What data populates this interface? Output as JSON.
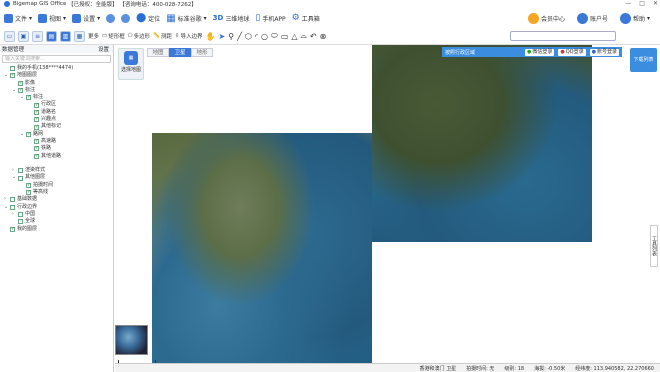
{
  "title": {
    "app": "Bigemap GIS Office",
    "license": "【已授权：全能版】",
    "phone": "【咨询电话：400-028-7262】"
  },
  "window_controls": [
    "—",
    "□",
    "✕"
  ],
  "menu": {
    "items": [
      "文件",
      "视图",
      "设置"
    ],
    "tools": [
      {
        "label": "定位",
        "icon": "pin-icon"
      },
      {
        "label": "标准谷歌",
        "icon": "grid-icon"
      },
      {
        "label": "三维地球",
        "icon": "3d-icon"
      },
      {
        "label": "手机APP",
        "icon": "phone-icon"
      },
      {
        "label": "工具箱",
        "icon": "gear-icon"
      }
    ],
    "right": [
      {
        "label": "会员中心"
      },
      {
        "label": "账户号"
      },
      {
        "label": "帮助"
      }
    ]
  },
  "toolbar": {
    "more": "更多",
    "items": [
      {
        "label": "矩形框"
      },
      {
        "label": "多边形"
      },
      {
        "label": "测距"
      },
      {
        "label": "导入边界"
      }
    ]
  },
  "panel": {
    "title": "数据管理",
    "action": "设置",
    "search_placeholder": "输入关键词搜索...",
    "tree": [
      {
        "label": "我的手机(138****4474)",
        "level": 0,
        "check": false,
        "arrow": ""
      },
      {
        "label": "地图图层",
        "level": 0,
        "check": true,
        "arrow": "⌄"
      },
      {
        "label": "影像",
        "level": 1,
        "check": true,
        "arrow": ""
      },
      {
        "label": "标注",
        "level": 1,
        "check": true,
        "arrow": "⌄"
      },
      {
        "label": "标注",
        "level": 2,
        "check": true,
        "arrow": "⌄"
      },
      {
        "label": "行政区",
        "level": 3,
        "check": true,
        "arrow": ""
      },
      {
        "label": "道路名",
        "level": 3,
        "check": true,
        "arrow": ""
      },
      {
        "label": "兴趣点",
        "level": 3,
        "check": true,
        "arrow": ""
      },
      {
        "label": "其他标记",
        "level": 3,
        "check": true,
        "arrow": ""
      },
      {
        "label": "路网",
        "level": 2,
        "check": true,
        "arrow": "⌄"
      },
      {
        "label": "高速路",
        "level": 3,
        "check": true,
        "arrow": ""
      },
      {
        "label": "铁路",
        "level": 3,
        "check": true,
        "arrow": ""
      },
      {
        "label": "其他道路",
        "level": 3,
        "check": true,
        "arrow": ""
      },
      {
        "label": "",
        "level": 0,
        "check": false,
        "arrow": ""
      },
      {
        "label": "渲染样式",
        "level": 1,
        "check": false,
        "arrow": "›"
      },
      {
        "label": "其他图层",
        "level": 1,
        "check": false,
        "arrow": "⌄"
      },
      {
        "label": "拍摄时间",
        "level": 2,
        "check": true,
        "arrow": ""
      },
      {
        "label": "等高线",
        "level": 2,
        "check": true,
        "arrow": ""
      },
      {
        "label": "基础数据",
        "level": 0,
        "check": false,
        "arrow": "›"
      },
      {
        "label": "行政边界",
        "level": 0,
        "check": false,
        "arrow": "⌄"
      },
      {
        "label": "中国",
        "level": 1,
        "check": false,
        "arrow": "›"
      },
      {
        "label": "全球",
        "level": 1,
        "check": false,
        "arrow": ""
      },
      {
        "label": "我的图层",
        "level": 0,
        "check": true,
        "arrow": ""
      }
    ]
  },
  "map": {
    "tabs": [
      "地图",
      "卫星",
      "地形"
    ],
    "active_tab": 1,
    "select_button": "选择地图",
    "bluebar": {
      "left": "按照行政区域",
      "wechat": "微信登录",
      "qq": "QQ登录",
      "account": "账号登录"
    },
    "right_button": "下载列表",
    "side_tab": "工具列表"
  },
  "status": {
    "place": "香港和澳门 卫星",
    "shoot_time": "拍摄时间: 无",
    "level": "级别: 18",
    "elevation": "海拔: -0.50米",
    "coords": "经纬度: 113.940582, 22.270660"
  }
}
